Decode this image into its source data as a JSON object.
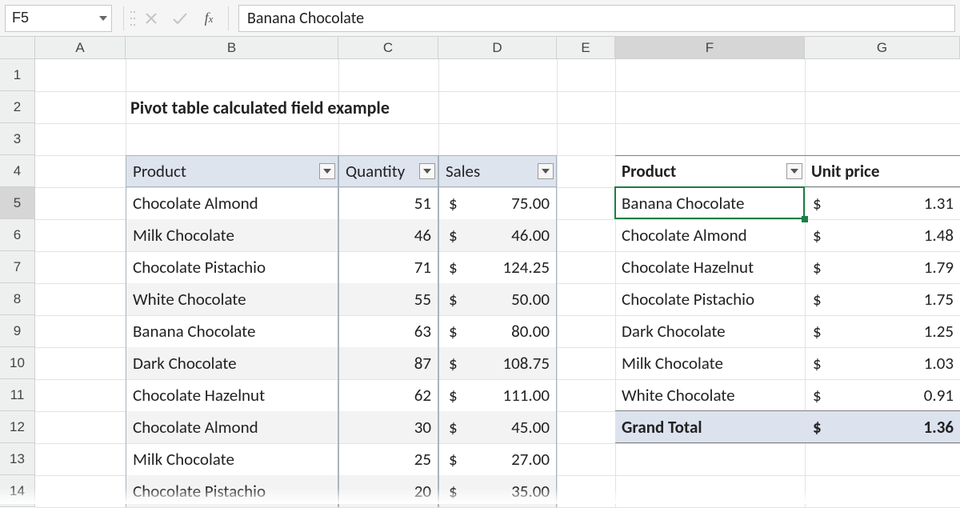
{
  "namebox": "F5",
  "formula_value": "Banana Chocolate",
  "columns": [
    "A",
    "B",
    "C",
    "D",
    "E",
    "F",
    "G"
  ],
  "row_numbers": [
    1,
    2,
    3,
    4,
    5,
    6,
    7,
    8,
    9,
    10,
    11,
    12,
    13,
    14
  ],
  "title": "Pivot table calculated field example",
  "table1": {
    "headers": {
      "product": "Product",
      "quantity": "Quantity",
      "sales": "Sales"
    },
    "rows": [
      {
        "product": "Chocolate Almond",
        "qty": "51",
        "sales": "75.00"
      },
      {
        "product": "Milk Chocolate",
        "qty": "46",
        "sales": "46.00"
      },
      {
        "product": "Chocolate Pistachio",
        "qty": "71",
        "sales": "124.25"
      },
      {
        "product": "White Chocolate",
        "qty": "55",
        "sales": "50.00"
      },
      {
        "product": "Banana Chocolate",
        "qty": "63",
        "sales": "80.00"
      },
      {
        "product": "Dark Chocolate",
        "qty": "87",
        "sales": "108.75"
      },
      {
        "product": "Chocolate Hazelnut",
        "qty": "62",
        "sales": "111.00"
      },
      {
        "product": "Chocolate Almond",
        "qty": "30",
        "sales": "45.00"
      },
      {
        "product": "Milk Chocolate",
        "qty": "25",
        "sales": "27.00"
      },
      {
        "product": "Chocolate Pistachio",
        "qty": "20",
        "sales": "35.00"
      }
    ]
  },
  "pivot": {
    "headers": {
      "product": "Product",
      "unit": "Unit price"
    },
    "rows": [
      {
        "product": "Banana Chocolate",
        "price": "1.31"
      },
      {
        "product": "Chocolate Almond",
        "price": "1.48"
      },
      {
        "product": "Chocolate Hazelnut",
        "price": "1.79"
      },
      {
        "product": "Chocolate Pistachio",
        "price": "1.75"
      },
      {
        "product": "Dark Chocolate",
        "price": "1.25"
      },
      {
        "product": "Milk Chocolate",
        "price": "1.03"
      },
      {
        "product": "White Chocolate",
        "price": "0.91"
      }
    ],
    "total_label": "Grand Total",
    "total_price": "1.36"
  },
  "currency": "$"
}
